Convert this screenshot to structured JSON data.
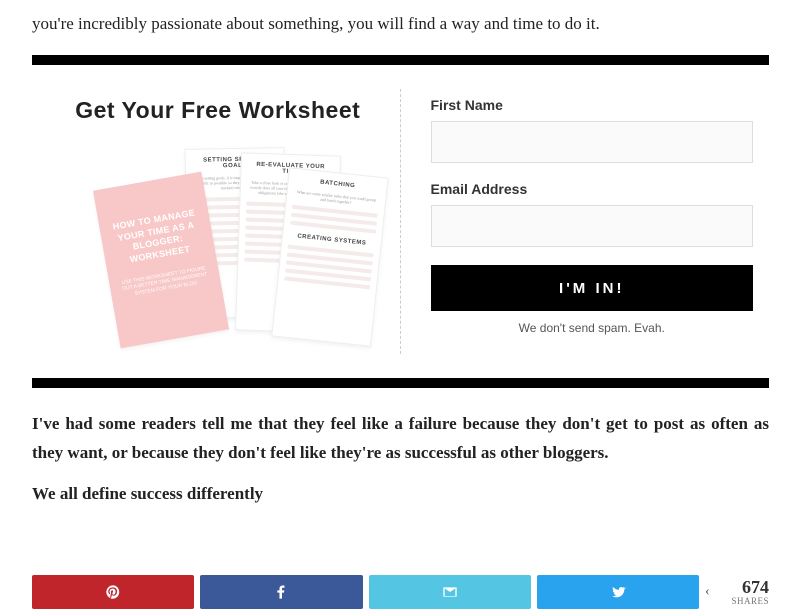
{
  "intro": "you're incredibly passionate about something, you will find a way and time to do it.",
  "optin": {
    "heading": "Get Your Free Worksheet",
    "cover_title": "HOW TO MANAGE YOUR TIME AS A BLOGGER: WORKSHEET",
    "cover_sub": "USE THIS WORKSHEET TO FIGURE OUT A BETTER TIME MANAGEMENT SYSTEM FOR YOUR BLOG",
    "page_headers": {
      "p1": "SETTING SPECIFIC GOALS",
      "p2": "RE-EVALUATE YOUR TIME",
      "p3a": "BATCHING",
      "p3b": "CREATING SYSTEMS"
    },
    "form": {
      "first_name_label": "First Name",
      "email_label": "Email Address",
      "submit_label": "I'M IN!",
      "disclaimer": "We don't send spam. Evah."
    }
  },
  "body_para": "I've had some readers tell me that they feel like a failure because they don't get to post as often as they want, or because they don't feel like they're as successful as other bloggers.",
  "cutoff": "We all define success differently",
  "share": {
    "count": "674",
    "count_label": "SHARES"
  }
}
